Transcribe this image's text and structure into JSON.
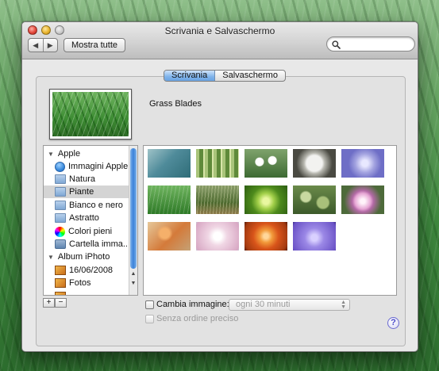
{
  "window": {
    "title": "Scrivania e Salvaschermo"
  },
  "toolbar": {
    "back_glyph": "◀",
    "forward_glyph": "▶",
    "show_all_label": "Mostra tutte",
    "search_placeholder": "",
    "search_icon": "search-icon"
  },
  "tabs": [
    {
      "label": "Scrivania",
      "active": true
    },
    {
      "label": "Salvaschermo",
      "active": false
    }
  ],
  "current_picture": {
    "name": "Grass Blades"
  },
  "sources": {
    "groups": [
      {
        "label": "Apple"
      },
      {
        "label": "Album iPhoto"
      }
    ],
    "items": [
      {
        "label": "Immagini Apple",
        "icon": "apple-icon",
        "selected": false
      },
      {
        "label": "Natura",
        "icon": "folder-icon",
        "selected": false
      },
      {
        "label": "Piante",
        "icon": "folder-icon",
        "selected": true
      },
      {
        "label": "Bianco e nero",
        "icon": "folder-icon",
        "selected": false
      },
      {
        "label": "Astratto",
        "icon": "folder-icon",
        "selected": false
      },
      {
        "label": "Colori pieni",
        "icon": "color-wheel-icon",
        "selected": false
      },
      {
        "label": "Cartella imma...",
        "icon": "folder-icon",
        "selected": false
      },
      {
        "label": "16/06/2008",
        "icon": "photo-album-icon",
        "selected": false
      },
      {
        "label": "Fotos",
        "icon": "photo-album-icon",
        "selected": false
      }
    ]
  },
  "controls": {
    "add_label": "+",
    "remove_label": "−",
    "change_picture_label": "Cambia immagine:",
    "change_picture_checked": false,
    "interval_value": "ogni 30 minuti",
    "random_order_label": "Senza ordine preciso",
    "random_order_checked": false,
    "help_label": "?"
  },
  "colors": {
    "accent": "#3b82d9",
    "window_bg": "#e8e8e8"
  }
}
